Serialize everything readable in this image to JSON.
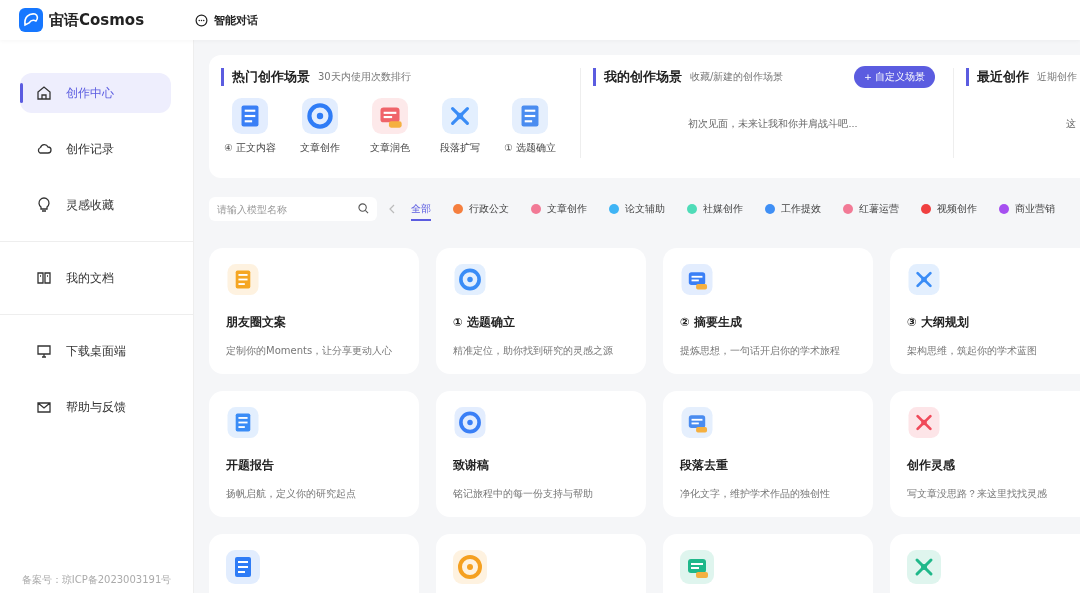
{
  "app": {
    "name": "宙语Cosmos"
  },
  "topbar": {
    "chat_link": "智能对话"
  },
  "sidebar": {
    "groups": [
      [
        {
          "label": "创作中心",
          "selected": true
        },
        {
          "label": "创作记录",
          "selected": false
        },
        {
          "label": "灵感收藏",
          "selected": false
        }
      ],
      [
        {
          "label": "我的文档",
          "selected": false
        }
      ],
      [
        {
          "label": "下载桌面端",
          "selected": false
        },
        {
          "label": "帮助与反馈",
          "selected": false
        }
      ]
    ],
    "footer": "备案号：琼ICP备2023003191号"
  },
  "hot": {
    "title": "热门创作场景",
    "subtitle": "30天内使用次数排行",
    "items": [
      {
        "label": "④ 正文内容",
        "color": "#3a7ff6"
      },
      {
        "label": "文章创作",
        "color": "#2f7cf6"
      },
      {
        "label": "文章润色",
        "color": "#f0646a"
      },
      {
        "label": "段落扩写",
        "color": "#3a8cf6"
      },
      {
        "label": "① 选题确立",
        "color": "#4a8cf0"
      }
    ]
  },
  "mine": {
    "title": "我的创作场景",
    "subtitle": "收藏/新建的创作场景",
    "button": "+ 自定义场景",
    "empty": "初次见面，未来让我和你并肩战斗吧..."
  },
  "recent": {
    "title": "最近创作",
    "subtitle": "近期创作",
    "empty": "这"
  },
  "search": {
    "placeholder": "请输入模型名称"
  },
  "categories": [
    {
      "label": "全部",
      "selected": true
    },
    {
      "label": "行政公文",
      "selected": false,
      "color": "#f57f3f"
    },
    {
      "label": "文章创作",
      "selected": false,
      "color": "#f27a96"
    },
    {
      "label": "论文辅助",
      "selected": false,
      "color": "#3fb4f5"
    },
    {
      "label": "社媒创作",
      "selected": false,
      "color": "#4fdcb8"
    },
    {
      "label": "工作提效",
      "selected": false,
      "color": "#3f8ff5"
    },
    {
      "label": "红薯运营",
      "selected": false,
      "color": "#f27a96"
    },
    {
      "label": "视频创作",
      "selected": false,
      "color": "#f04040"
    },
    {
      "label": "商业营销",
      "selected": false,
      "color": "#a64ff0"
    }
  ],
  "cards": [
    {
      "kind": "full",
      "title": "朋友圈文案",
      "desc": "定制你的Moments，让分享更动人心",
      "color": "#f5a623"
    },
    {
      "kind": "full",
      "title": "① 选题确立",
      "desc": "精准定位，助你找到研究的灵感之源",
      "color": "#3a8cf6"
    },
    {
      "kind": "full",
      "title": "② 摘要生成",
      "desc": "提炼思想，一句话开启你的学术旅程",
      "color": "#3a7ff6"
    },
    {
      "kind": "full",
      "title": "③ 大纲规划",
      "desc": "架构思维，筑起你的学术蓝图",
      "color": "#3a8cf6"
    },
    {
      "kind": "full",
      "title": "开题报告",
      "desc": "扬帆启航，定义你的研究起点",
      "color": "#3a8cf6"
    },
    {
      "kind": "full",
      "title": "致谢稿",
      "desc": "铭记旅程中的每一份支持与帮助",
      "color": "#3a7ff6"
    },
    {
      "kind": "full",
      "title": "段落去重",
      "desc": "净化文字，维护学术作品的独创性",
      "color": "#4a8cf0"
    },
    {
      "kind": "full",
      "title": "创作灵感",
      "desc": "写文章没思路？来这里找找灵感",
      "color": "#f04a5a"
    },
    {
      "kind": "partial",
      "color": "#2f7cf6"
    },
    {
      "kind": "partial",
      "color": "#f5a020"
    },
    {
      "kind": "partial",
      "color": "#1fb88a"
    },
    {
      "kind": "partial",
      "color": "#1fb88a"
    }
  ]
}
